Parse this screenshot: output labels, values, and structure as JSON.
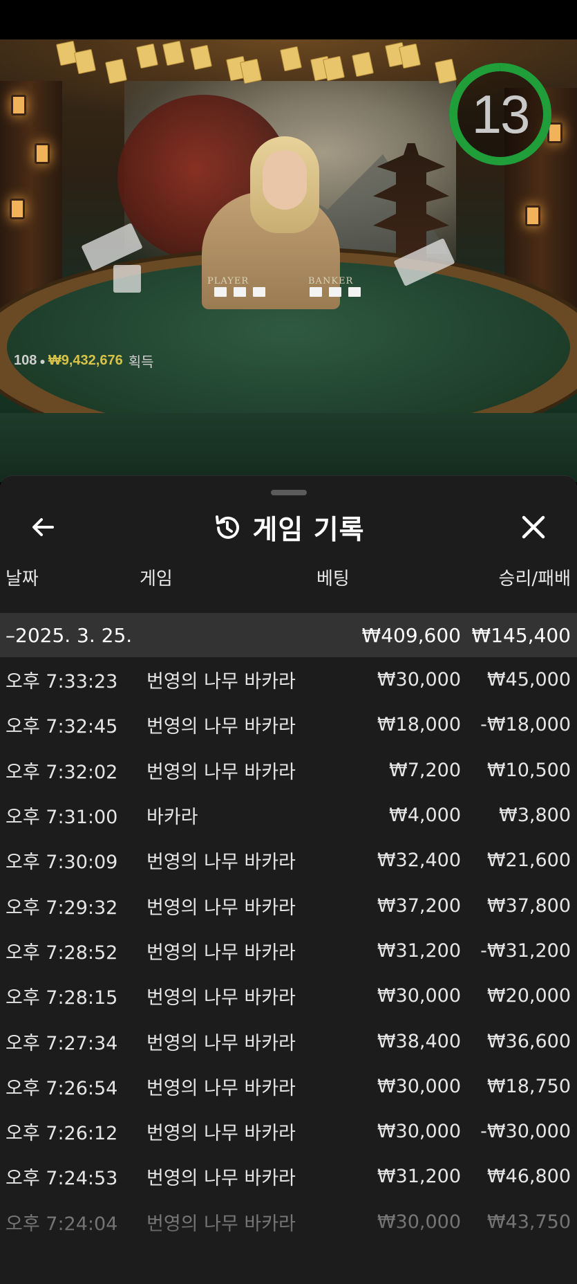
{
  "stream": {
    "timer": "13",
    "players_count": "108",
    "winnings_amount": "₩9,432,676",
    "winnings_label": "획득",
    "felt_labels": [
      "PLAYER",
      "BANKER"
    ]
  },
  "sheet": {
    "title": "게임 기록",
    "back_icon": "arrow-left-icon",
    "history_icon": "history-icon",
    "close_icon": "close-icon",
    "columns": {
      "date": "날짜",
      "game": "게임",
      "bet": "베팅",
      "win_loss": "승리/패배"
    },
    "date_group": {
      "label": "–2025. 3. 25.",
      "bet_total": "₩409,600",
      "win_total": "₩145,400"
    },
    "rows": [
      {
        "time": "오후 7:33:23",
        "game": "번영의 나무 바카라",
        "bet": "₩30,000",
        "win": "₩45,000"
      },
      {
        "time": "오후 7:32:45",
        "game": "번영의 나무 바카라",
        "bet": "₩18,000",
        "win": "-₩18,000"
      },
      {
        "time": "오후 7:32:02",
        "game": "번영의 나무 바카라",
        "bet": "₩7,200",
        "win": "₩10,500"
      },
      {
        "time": "오후 7:31:00",
        "game": "바카라",
        "bet": "₩4,000",
        "win": "₩3,800"
      },
      {
        "time": "오후 7:30:09",
        "game": "번영의 나무 바카라",
        "bet": "₩32,400",
        "win": "₩21,600"
      },
      {
        "time": "오후 7:29:32",
        "game": "번영의 나무 바카라",
        "bet": "₩37,200",
        "win": "₩37,800"
      },
      {
        "time": "오후 7:28:52",
        "game": "번영의 나무 바카라",
        "bet": "₩31,200",
        "win": "-₩31,200"
      },
      {
        "time": "오후 7:28:15",
        "game": "번영의 나무 바카라",
        "bet": "₩30,000",
        "win": "₩20,000"
      },
      {
        "time": "오후 7:27:34",
        "game": "번영의 나무 바카라",
        "bet": "₩38,400",
        "win": "₩36,600"
      },
      {
        "time": "오후 7:26:54",
        "game": "번영의 나무 바카라",
        "bet": "₩30,000",
        "win": "₩18,750"
      },
      {
        "time": "오후 7:26:12",
        "game": "번영의 나무 바카라",
        "bet": "₩30,000",
        "win": "-₩30,000"
      },
      {
        "time": "오후 7:24:53",
        "game": "번영의 나무 바카라",
        "bet": "₩31,200",
        "win": "₩46,800"
      },
      {
        "time": "오후 7:24:04",
        "game": "번영의 나무 바카라",
        "bet": "₩30,000",
        "win": "₩43,750"
      }
    ]
  },
  "colors": {
    "sheet_bg": "#1c1c1c",
    "date_row_bg": "#333333",
    "timer_ring": "#1f9e3a",
    "winnings_gold": "#d8c34a"
  }
}
